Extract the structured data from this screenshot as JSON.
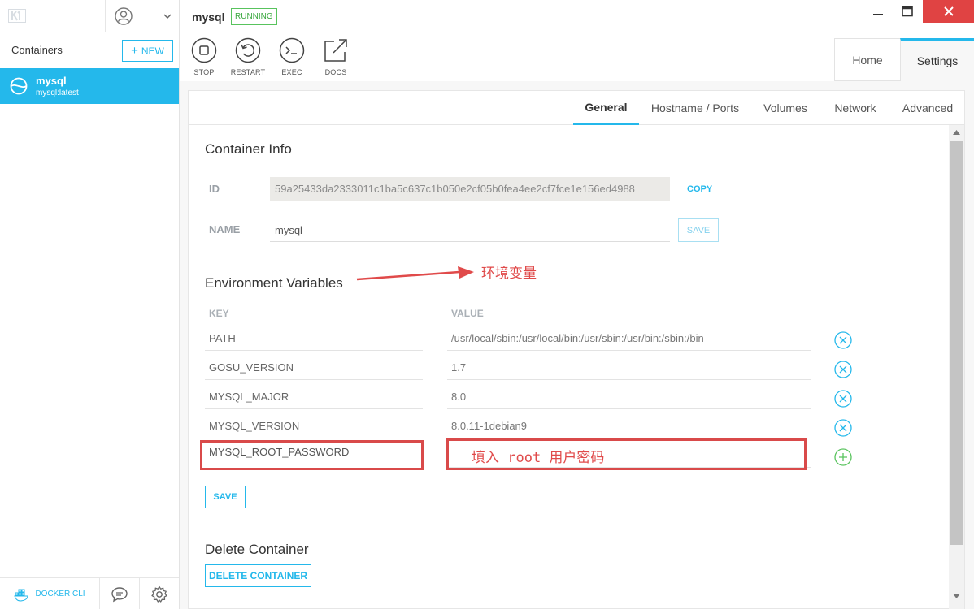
{
  "app": {
    "active_container": "mysql",
    "status": "RUNNING",
    "colors": {
      "accent": "#24b8eb",
      "running": "#58c35d",
      "annotation": "#e04a4a",
      "close": "#e04343"
    }
  },
  "sidebar": {
    "containers_title": "Containers",
    "new_label": "NEW",
    "items": [
      {
        "name": "mysql",
        "image": "mysql:latest"
      }
    ],
    "docker_cli_label": "DOCKER CLI"
  },
  "toolbar": {
    "actions": [
      {
        "label": "STOP",
        "icon": "stop-icon"
      },
      {
        "label": "RESTART",
        "icon": "restart-icon"
      },
      {
        "label": "EXEC",
        "icon": "terminal-icon"
      },
      {
        "label": "DOCS",
        "icon": "external-link-icon"
      }
    ]
  },
  "tabs": {
    "home": "Home",
    "settings": "Settings"
  },
  "subtabs": [
    "General",
    "Hostname / Ports",
    "Volumes",
    "Network",
    "Advanced"
  ],
  "container_info": {
    "title": "Container Info",
    "id_label": "ID",
    "id_value": "59a25433da2333011c1ba5c637c1b050e2cf05b0fea4ee2cf7fce1e156ed4988",
    "copy_label": "COPY",
    "name_label": "NAME",
    "name_value": "mysql",
    "save_label": "SAVE"
  },
  "env": {
    "title": "Environment Variables",
    "annotation": "环境变量",
    "key_header": "KEY",
    "value_header": "VALUE",
    "rows": [
      {
        "key": "PATH",
        "value": "/usr/local/sbin:/usr/local/bin:/usr/sbin:/usr/bin:/sbin:/bin"
      },
      {
        "key": "GOSU_VERSION",
        "value": "1.7"
      },
      {
        "key": "MYSQL_MAJOR",
        "value": "8.0"
      },
      {
        "key": "MYSQL_VERSION",
        "value": "8.0.11-1debian9"
      }
    ],
    "new_key": "MYSQL_ROOT_PASSWORD",
    "new_value_annotation": "填入 root 用户密码",
    "save_label": "SAVE"
  },
  "delete": {
    "title": "Delete Container",
    "button_label": "DELETE CONTAINER"
  }
}
